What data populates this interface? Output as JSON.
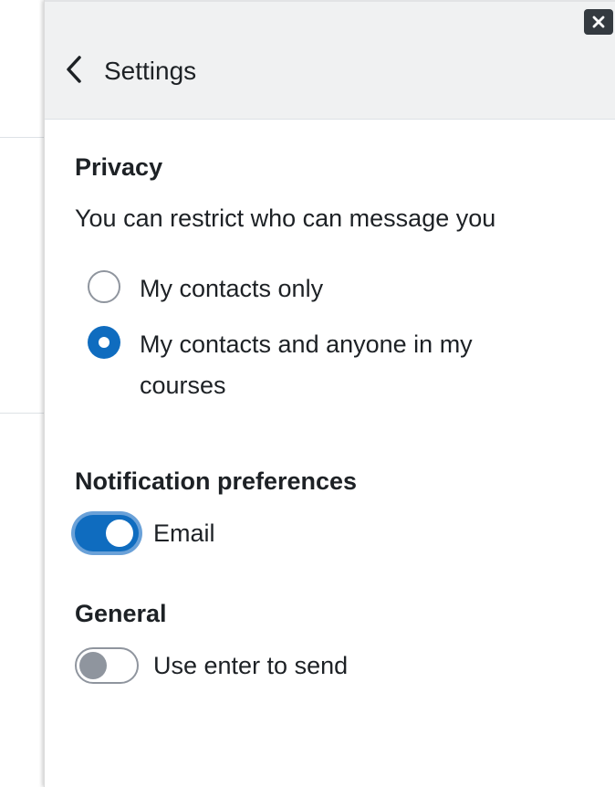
{
  "header": {
    "title": "Settings",
    "back_icon": "chevron-left-icon",
    "close_icon": "close-icon"
  },
  "privacy": {
    "title": "Privacy",
    "description": "You can restrict who can message you",
    "options": [
      {
        "label": "My contacts only",
        "selected": false
      },
      {
        "label": "My contacts and anyone in my courses",
        "selected": true
      }
    ]
  },
  "notifications": {
    "title": "Notification preferences",
    "email_label": "Email",
    "email_enabled": true
  },
  "general": {
    "title": "General",
    "enter_to_send_label": "Use enter to send",
    "enter_to_send_enabled": false
  },
  "colors": {
    "accent": "#0f6cbf",
    "header_bg": "#f0f1f2",
    "close_button_bg": "#343a40"
  }
}
